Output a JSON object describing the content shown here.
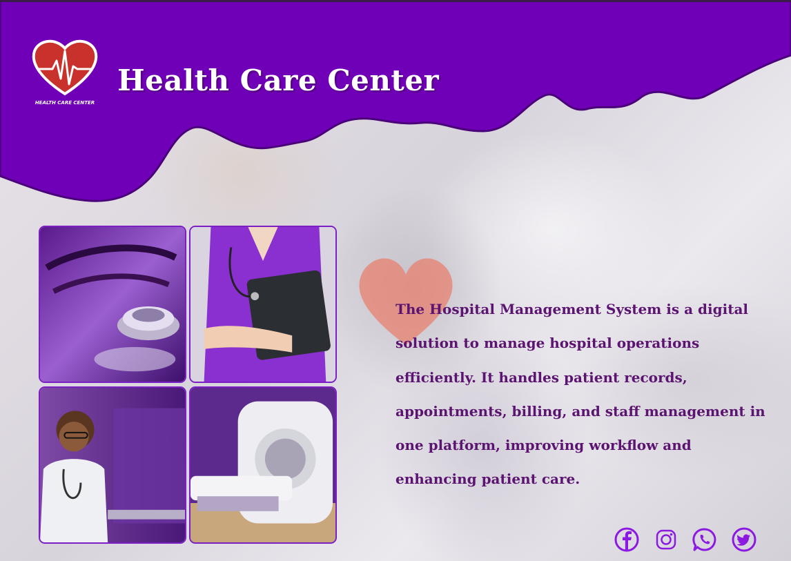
{
  "brand": {
    "logo_text": "HEALTH CARE CENTER",
    "title": "Health Care Center"
  },
  "gallery": {
    "photos": [
      {
        "subject": "stethoscope"
      },
      {
        "subject": "nurse holding folder"
      },
      {
        "subject": "doctor at desk"
      },
      {
        "subject": "MRI scanner"
      }
    ]
  },
  "description": "The Hospital Management System is a digital solution to manage hospital operations efficiently. It handles patient records, appointments, billing, and staff management in one platform, improving workflow and enhancing patient care.",
  "social": {
    "icons": [
      "facebook-icon",
      "instagram-icon",
      "whatsapp-icon",
      "twitter-icon"
    ]
  },
  "colors": {
    "accent": "#7000b8",
    "text": "#5b1470",
    "logo_heart": "#c8312c"
  }
}
